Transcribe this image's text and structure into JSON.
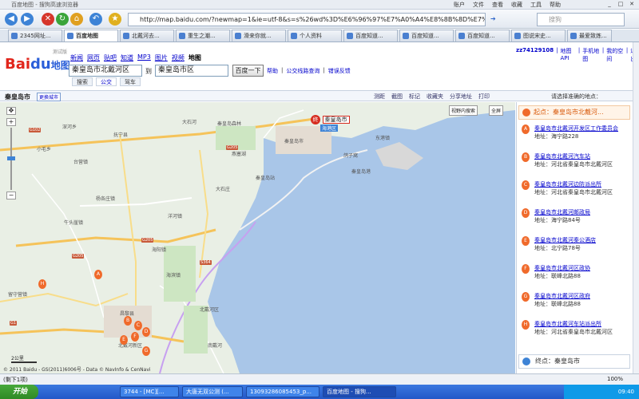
{
  "browser": {
    "title": "百度地图 - 搜狗高速浏览器",
    "menu": [
      "账户",
      "文件",
      "查看",
      "收藏",
      "工具",
      "帮助"
    ],
    "url": "http://map.baidu.com/?newmap=1&ie=utf-8&s=s%26wd%3D%E6%96%97%E7%A0%A4%E8%8B%8D%E7%A9",
    "search_placeholder": "搜狗",
    "tabs": [
      "2345网址...",
      "百度地图",
      "北戴河去...",
      "重生之潮...",
      "滑来你就...",
      "个人资料",
      "百度知道...",
      "百度知道...",
      "百度知道...",
      "图说宋史...",
      "最爱致炼..."
    ],
    "active_tab": 1
  },
  "header": {
    "logo_left": "Bai",
    "logo_mid": "du",
    "logo_right": "地图",
    "beta": "测试版",
    "nav": [
      "新闻",
      "网页",
      "贴吧",
      "知道",
      "MP3",
      "图片",
      "视频",
      "地图"
    ],
    "user_links": [
      "zz74129108",
      "|",
      "地图API",
      "|",
      "手机地图",
      "|",
      "我的空间",
      "|",
      "退出"
    ],
    "from_value": "秦皇岛市北戴河区",
    "to_label": "到",
    "to_value": "秦皇岛市区",
    "search_button": "百度一下",
    "help_links": [
      "帮助",
      "|",
      "公交线路查询",
      "|",
      "错误反馈"
    ],
    "subtabs": [
      "搜索",
      "公交",
      "驾车"
    ]
  },
  "strip": {
    "city": "秦皇岛市",
    "change_city": "更换城市",
    "tools": [
      "测距",
      "截图",
      "标记",
      "收藏夹",
      "分享地址",
      "打印"
    ],
    "pick_hint": "请选择准确的地点："
  },
  "map": {
    "labels": [
      "秦皇岛市",
      "海港区",
      "大石河",
      "秦皇岛森林",
      "北戴河区",
      "海滨镇",
      "抚宁县",
      "深河乡",
      "小毛乡",
      "台营镇",
      "牛头崖镇",
      "洋河镇",
      "杨各庄镇",
      "北戴河新区",
      "秦皇岛站",
      "大石庄",
      "南戴河",
      "昌黎县",
      "秦皇岛港",
      "鸽子窝",
      "燕塞湖",
      "东港镇",
      "留守营镇",
      "海阳镇"
    ],
    "roads": [
      "G102",
      "G205",
      "G1",
      "S364",
      "G205",
      "G205"
    ],
    "city_pin": "秦皇岛市",
    "btn_view": "视野内搜索",
    "btn_full": "全屏",
    "scale": "2公里",
    "copyright": "© 2011 Baidu - GS(2011)6006号 - Data © NavInfo & CenNavi"
  },
  "sidebar": {
    "start_label": "起点：",
    "start_value": "秦皇岛市北戴河...",
    "results": [
      {
        "mark": "A",
        "name": "秦皇岛市北戴河开发区工作委员会",
        "addr": "地址：海宁路228"
      },
      {
        "mark": "B",
        "name": "秦皇岛市北戴河汽车站",
        "addr": "地址：河北省秦皇岛市北戴河区"
      },
      {
        "mark": "C",
        "name": "秦皇岛市北戴河边防派出所",
        "addr": "地址：河北省秦皇岛市北戴河区"
      },
      {
        "mark": "D",
        "name": "秦皇岛市北戴河邮政局",
        "addr": "地址：海宁路84号"
      },
      {
        "mark": "E",
        "name": "秦皇岛市北戴河秦公酒店",
        "addr": "地址：北宁路78号"
      },
      {
        "mark": "F",
        "name": "秦皇岛市北戴河区政协",
        "addr": "地址：联峰北路88"
      },
      {
        "mark": "G",
        "name": "秦皇岛市北戴河区政府",
        "addr": "地址：联峰北路88"
      },
      {
        "mark": "H",
        "name": "秦皇岛市北戴河车站派出所",
        "addr": "地址：河北省秦皇岛市北戴河区"
      }
    ],
    "end_label": "终点：",
    "end_value": "秦皇岛市"
  },
  "status": {
    "left": "(剩下1项)",
    "right": "100%"
  },
  "taskbar": {
    "start": "开始",
    "tasks": [
      "3744 - [MC][...",
      "大唐无双公测 (...",
      "13093286085453_p...",
      "百度地图 - 搜狗..."
    ],
    "clock": "09:40"
  },
  "colors": {
    "accent": "#2b5fd9",
    "brand_red": "#e1251b",
    "water": "#a9c6e8",
    "land": "#e9efe5",
    "marker": "#f06a2b"
  }
}
